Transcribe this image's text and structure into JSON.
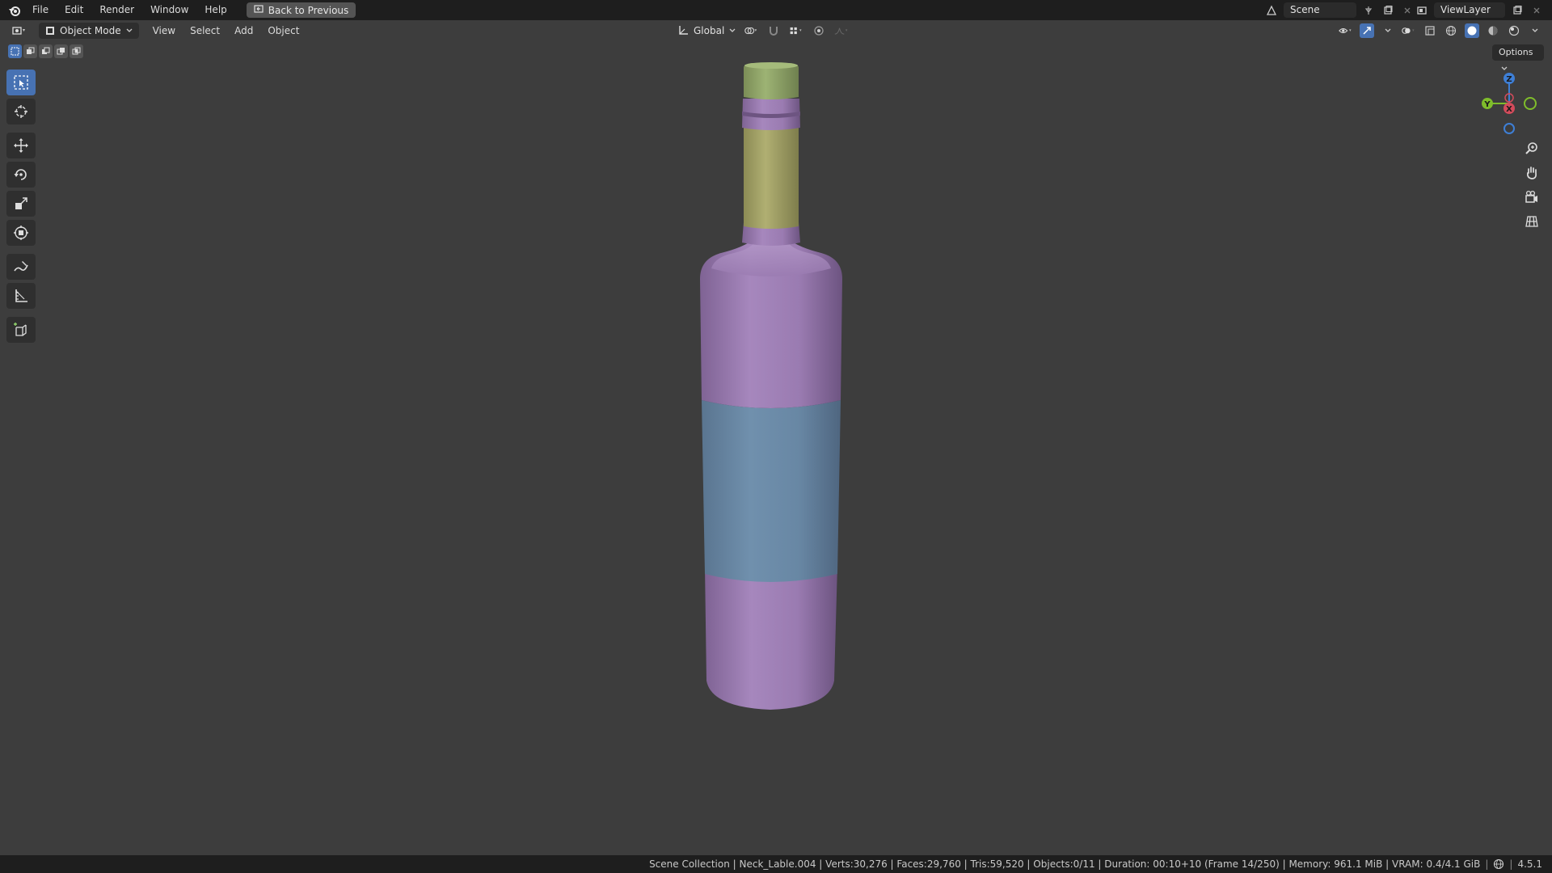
{
  "menubar": {
    "items": [
      "File",
      "Edit",
      "Render",
      "Window",
      "Help"
    ],
    "back_label": "Back to Previous",
    "scene_name": "Scene",
    "view_layer": "ViewLayer"
  },
  "header": {
    "mode_label": "Object Mode",
    "menus": [
      "View",
      "Select",
      "Add",
      "Object"
    ],
    "transform_orientation": "Global"
  },
  "viewport": {
    "options_label": "Options",
    "gizmo_axes": [
      "Z",
      "Y",
      "X"
    ]
  },
  "statusbar": {
    "text": "Scene Collection | Neck_Lable.004 | Verts:30,276 | Faces:29,760 | Tris:59,520 | Objects:0/11 | Duration: 00:10+10 (Frame 14/250) | Memory: 961.1 MiB | VRAM: 0.4/4.1 GiB",
    "version": "4.5.1"
  },
  "colors": {
    "background": "#3d3d3d",
    "bottle_purple": "#9b7bb3",
    "label_blue": "#6a88a8",
    "neck_label": "#a9a866",
    "cap_green": "#93a86a",
    "accent": "#4772b3"
  }
}
